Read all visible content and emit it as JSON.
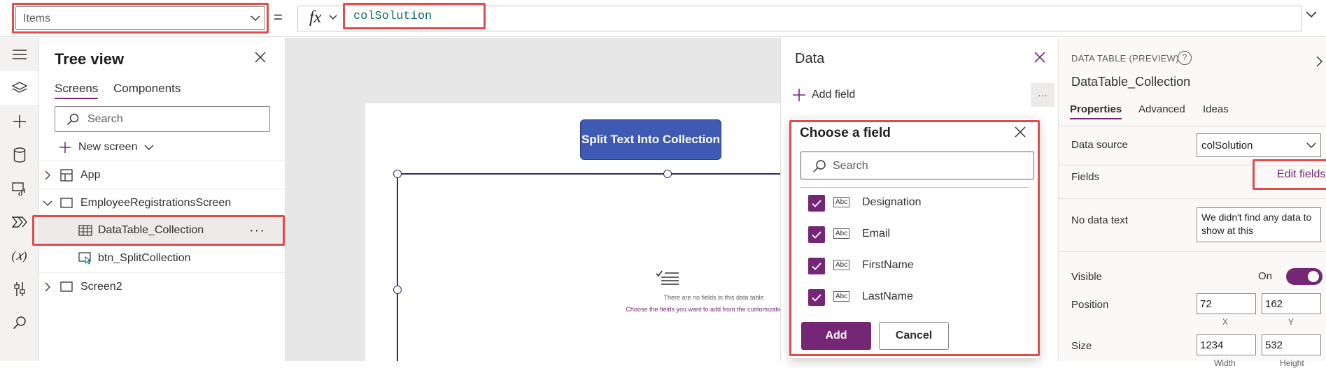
{
  "formula_bar": {
    "property": "Items",
    "equals": "=",
    "fx_label": "fx",
    "formula": "colSolution"
  },
  "tree_view": {
    "title": "Tree view",
    "tabs": [
      "Screens",
      "Components"
    ],
    "search_placeholder": "Search",
    "new_screen_label": "New screen",
    "items": [
      {
        "label": "App"
      },
      {
        "label": "EmployeeRegistrationsScreen"
      },
      {
        "label": "DataTable_Collection",
        "more": "···"
      },
      {
        "label": "btn_SplitCollection"
      },
      {
        "label": "Screen2"
      }
    ]
  },
  "canvas": {
    "button_label": "Split Text Into Collection",
    "empty_title": "There are no fields in this data table",
    "empty_subtitle": "Choose the fields you want to add from the customization pane"
  },
  "data_panel": {
    "title": "Data",
    "add_field_label": "Add field",
    "more_label": "···"
  },
  "chooser": {
    "title": "Choose a field",
    "search_placeholder": "Search",
    "type_badge": "Abc",
    "fields": [
      {
        "name": "Designation",
        "checked": true
      },
      {
        "name": "Email",
        "checked": true
      },
      {
        "name": "FirstName",
        "checked": true
      },
      {
        "name": "LastName",
        "checked": true
      }
    ],
    "add_label": "Add",
    "cancel_label": "Cancel"
  },
  "properties": {
    "control_type": "DATA TABLE (PREVIEW)",
    "help": "?",
    "control_name": "DataTable_Collection",
    "tabs": [
      "Properties",
      "Advanced",
      "Ideas"
    ],
    "data_source_label": "Data source",
    "data_source_value": "colSolution",
    "fields_label": "Fields",
    "edit_fields_label": "Edit fields",
    "no_data_label": "No data text",
    "no_data_value": "We didn't find any data to show at this",
    "visible_label": "Visible",
    "visible_value": "On",
    "position_label": "Position",
    "position_x": "72",
    "position_y": "162",
    "x_label": "X",
    "y_label": "Y",
    "size_label": "Size",
    "size_width": "1234",
    "size_height": "532",
    "width_label": "Width",
    "height_label": "Height"
  },
  "colors": {
    "accent": "#742774",
    "highlight_box": "#e04c4c",
    "button_blue": "#3f5ab3"
  }
}
